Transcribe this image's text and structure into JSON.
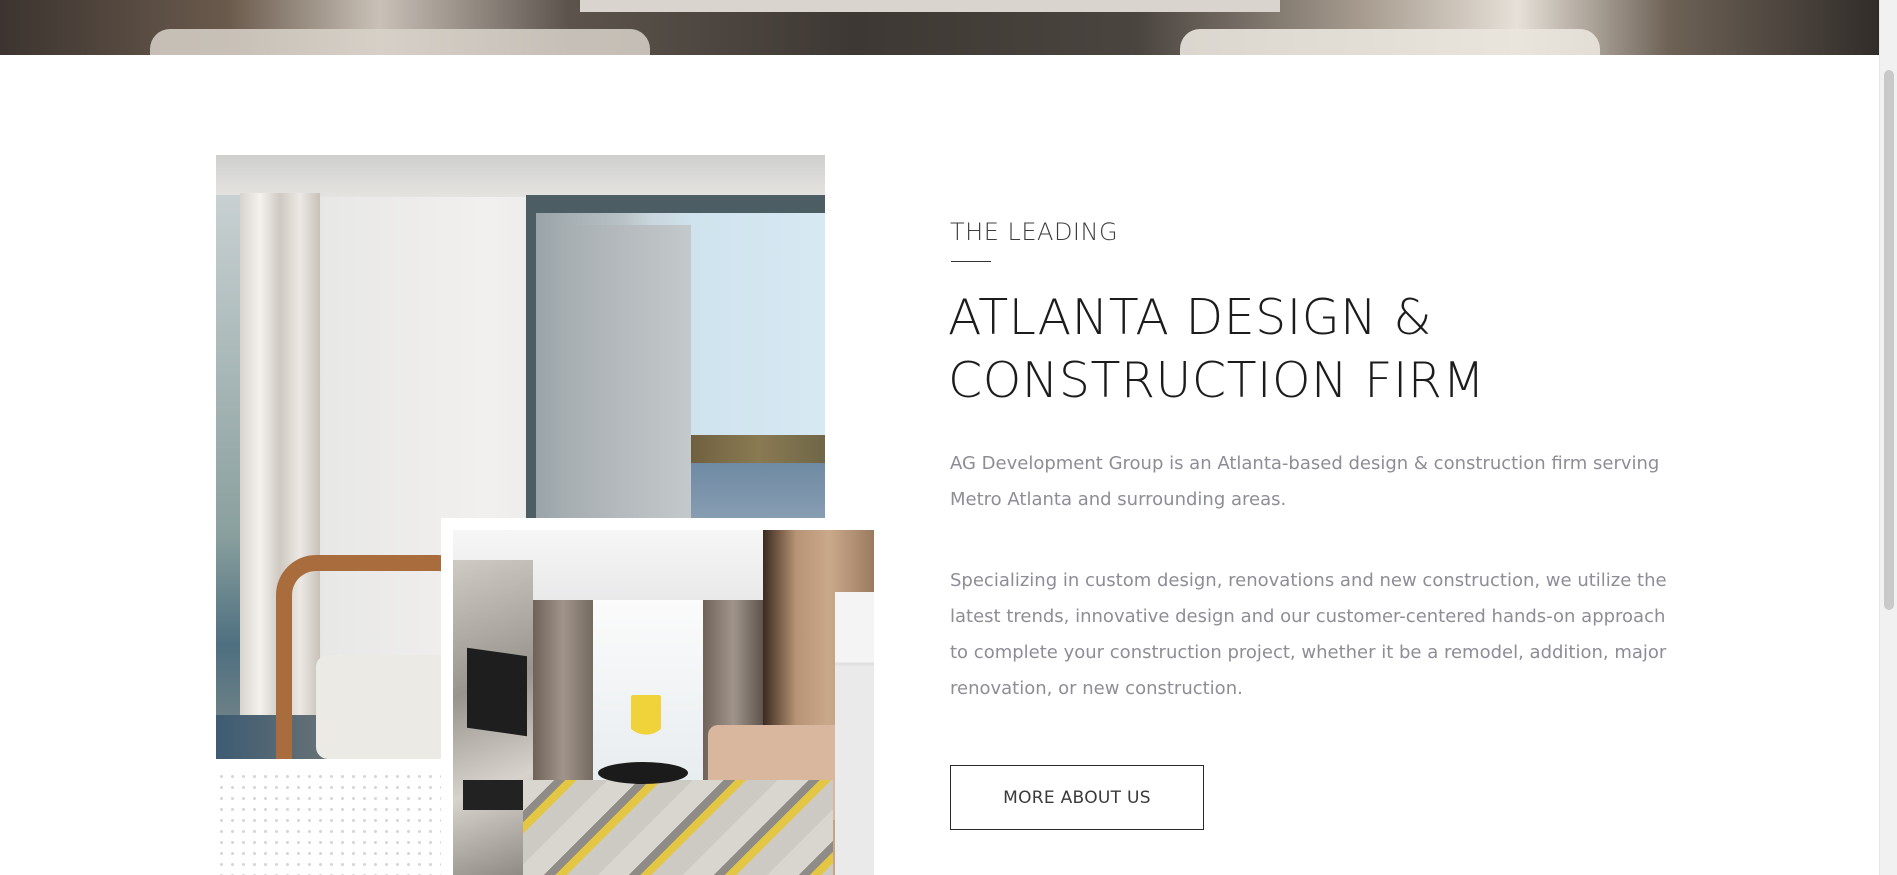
{
  "hero": {
    "image": "living-room-banner"
  },
  "intro": {
    "eyebrow": "THE LEADING",
    "title": "ATLANTA DESIGN & CONSTRUCTION FIRM",
    "paragraph_1": "AG Development Group is an Atlanta-based design & construction firm serving Metro Atlanta and surrounding areas.",
    "paragraph_2": "Specializing in custom design, renovations and new construction, we utilize the latest trends, innovative design and our customer-centered hands-on approach to complete your construction project, whether it be a remodel, addition, major renovation, or new construction.",
    "button_label": "MORE ABOUT US"
  },
  "images": {
    "main": "interior-window-lake-view",
    "inset": "modern-living-room"
  },
  "colors": {
    "heading": "#1c1c1c",
    "body_text": "#8d8d96",
    "button_border": "#2a2a2a"
  }
}
